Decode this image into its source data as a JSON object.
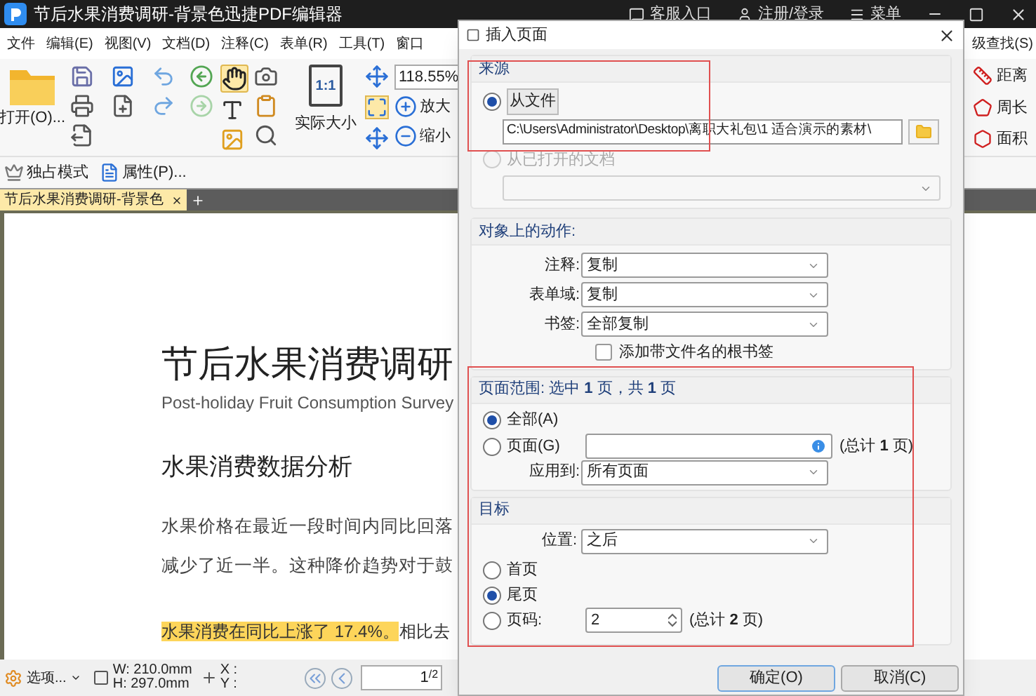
{
  "title_bar": {
    "title": "节后水果消费调研-背景色迅捷PDF编辑器",
    "links": [
      {
        "label": "客服入口"
      },
      {
        "label": "注册/登录"
      },
      {
        "label": "菜单"
      }
    ]
  },
  "menu_bar": {
    "items": [
      "文件",
      "编辑(E)",
      "视图(V)",
      "文档(D)",
      "注释(C)",
      "表单(R)",
      "工具(T)",
      "窗口"
    ],
    "right_item": "级查找(S)"
  },
  "toolbar": {
    "open_label": "打开(O)...",
    "actual_size_label": "实际大小",
    "actual_size_icon_text": "1:1",
    "zoom_value": "118.55%",
    "zoom_in": "放大",
    "zoom_out": "缩小",
    "measure_tools": [
      "距离",
      "周长",
      "面积"
    ]
  },
  "secondary_toolbar": {
    "items": [
      "独占模式",
      "属性(P)..."
    ]
  },
  "tabs": [
    {
      "label": "节后水果消费调研-背景色",
      "selected": true
    }
  ],
  "document": {
    "title": "节后水果消费调研",
    "subtitle": "Post-holiday Fruit Consumption Survey",
    "heading": "水果消费数据分析",
    "paragraph_lines": [
      "水果价格在最近一段时间内同比回落",
      "减少了近一半。这种降价趋势对于鼓"
    ],
    "highlighted": "水果消费在同比上涨了 17.4%。",
    "after_highlight": "相比去"
  },
  "status_bar": {
    "options": "选项...",
    "width": "W: 210.0mm",
    "height": "H: 297.0mm",
    "x": "X :",
    "y": "Y :",
    "page_value": "1",
    "page_total": "/2"
  },
  "dialog": {
    "title": "插入页面",
    "source": {
      "heading": "来源",
      "options": [
        {
          "label": "从文件",
          "selected": true,
          "disabled": false
        },
        {
          "label": "从已打开的文档",
          "selected": false,
          "disabled": true
        }
      ],
      "file_path": "C:\\Users\\Administrator\\Desktop\\离职大礼包\\1 适合演示的素材\\"
    },
    "actions": {
      "heading": "对象上的动作:",
      "fields": [
        {
          "label": "注释:",
          "value": "复制"
        },
        {
          "label": "表单域:",
          "value": "复制"
        },
        {
          "label": "书签:",
          "value": "全部复制"
        }
      ],
      "root_bookmark": {
        "label": "添加带文件名的根书签",
        "checked": false
      }
    },
    "page_range": {
      "heading": "页面范围: 选中 **1** 页，共 **1** 页",
      "options": [
        {
          "label": "全部(A)",
          "selected": true
        },
        {
          "label": "页面(G)",
          "selected": false
        }
      ],
      "pages_total": "(总计 **1** 页)",
      "apply_label": "应用到:",
      "apply_value": "所有页面"
    },
    "target": {
      "heading": "目标",
      "position_label": "位置:",
      "position_value": "之后",
      "options": [
        {
          "label": "首页",
          "selected": false,
          "kind": "plain"
        },
        {
          "label": "尾页",
          "selected": true,
          "kind": "plain"
        },
        {
          "label": "页码:",
          "selected": false,
          "kind": "page_number"
        }
      ],
      "page_number": "2",
      "total": "(总计 **2** 页)"
    },
    "buttons": [
      {
        "label": "确定(O)",
        "kind": "primary"
      },
      {
        "label": "取消(C)",
        "kind": "secondary"
      }
    ]
  }
}
